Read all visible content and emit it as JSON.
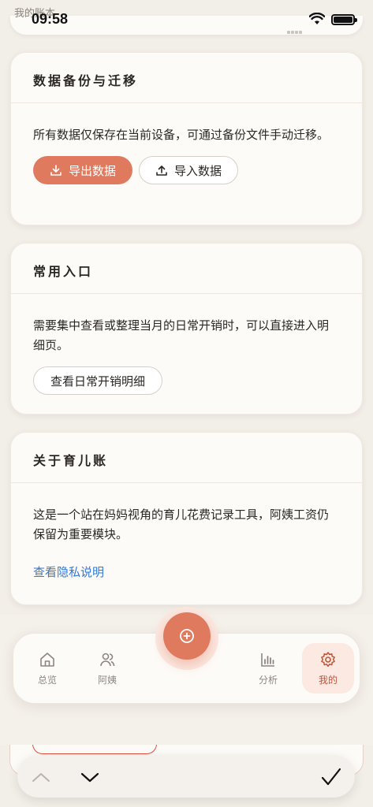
{
  "status_bar": {
    "behind_title": "我的账本",
    "time": "09:58"
  },
  "backup_card": {
    "title": "数据备份与迁移",
    "description": "所有数据仅保存在当前设备，可通过备份文件手动迁移。",
    "export_label": "导出数据",
    "import_label": "导入数据"
  },
  "entry_card": {
    "title": "常用入口",
    "description": "需要集中查看或整理当月的日常开销时，可以直接进入明细页。",
    "detail_button": "查看日常开销明细"
  },
  "about_card": {
    "title": "关于育儿账",
    "description": "这是一个站在妈妈视角的育儿花费记录工具，阿姨工资仍保留为重要模块。",
    "privacy_link": "查看隐私说明"
  },
  "tabbar": {
    "items": [
      {
        "label": "总览",
        "icon": "home-icon"
      },
      {
        "label": "阿姨",
        "icon": "people-icon"
      },
      {
        "label": "分析",
        "icon": "bar-chart-icon"
      },
      {
        "label": "我的",
        "icon": "gear-icon"
      }
    ],
    "active": "我的",
    "add_icon": "add-circle-icon"
  },
  "colors": {
    "accent": "#e07a5f",
    "background": "#f2eee8",
    "card": "#fdfbf8",
    "link": "#2f7ad9"
  }
}
